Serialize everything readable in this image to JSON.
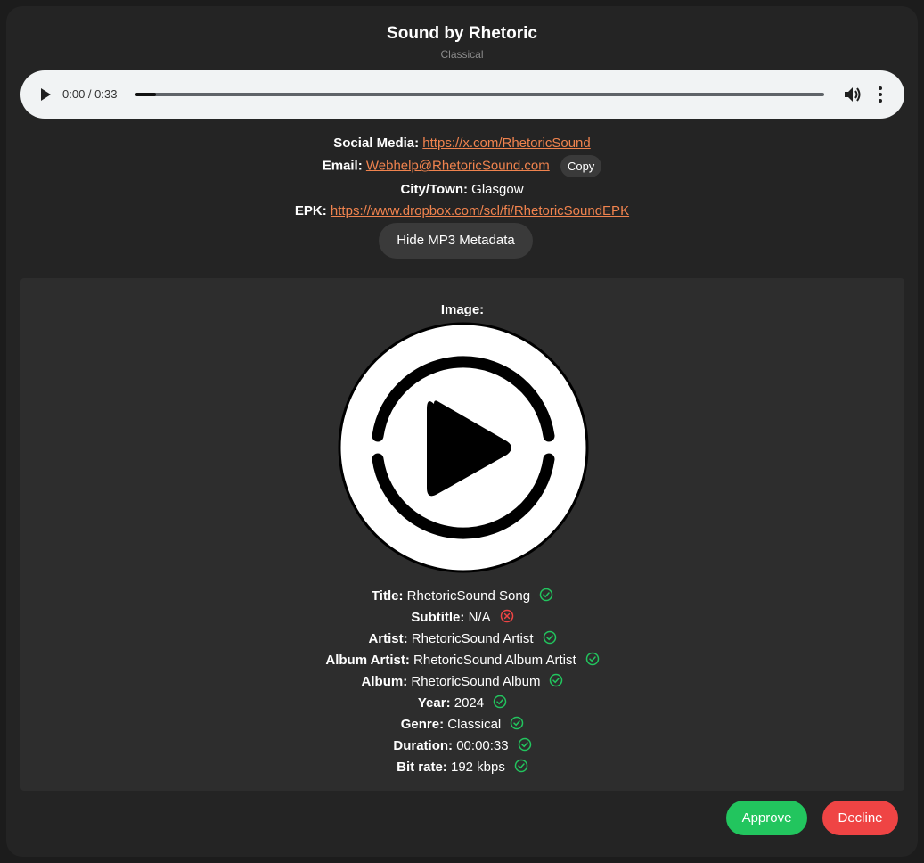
{
  "header": {
    "title": "Sound by Rhetoric",
    "genre": "Classical"
  },
  "player": {
    "time": "0:00 / 0:33",
    "progress_fraction": 0.03,
    "play_icon": "play-icon",
    "volume_icon": "volume-icon",
    "more_icon": "more-vertical-icon"
  },
  "info": {
    "social_label": "Social Media:",
    "social_value": "https://x.com/RhetoricSound",
    "email_label": "Email:",
    "email_value": "Webhelp@RhetoricSound.com",
    "copy_label": "Copy",
    "city_label": "City/Town:",
    "city_value": "Glasgow",
    "epk_label": "EPK:",
    "epk_value": "https://www.dropbox.com/scl/fi/RhetoricSoundEPK"
  },
  "toggle": {
    "label": "Hide MP3 Metadata"
  },
  "metadata": {
    "image_label": "Image:",
    "rows": [
      {
        "label": "Title:",
        "value": "RhetoricSound Song",
        "ok": true
      },
      {
        "label": "Subtitle:",
        "value": "N/A",
        "ok": false
      },
      {
        "label": "Artist:",
        "value": "RhetoricSound Artist",
        "ok": true
      },
      {
        "label": "Album Artist:",
        "value": "RhetoricSound Album Artist",
        "ok": true
      },
      {
        "label": "Album:",
        "value": "RhetoricSound Album",
        "ok": true
      },
      {
        "label": "Year:",
        "value": "2024",
        "ok": true
      },
      {
        "label": "Genre:",
        "value": "Classical",
        "ok": true
      },
      {
        "label": "Duration:",
        "value": "00:00:33",
        "ok": true
      },
      {
        "label": "Bit rate:",
        "value": "192 kbps",
        "ok": true
      }
    ]
  },
  "actions": {
    "approve_label": "Approve",
    "decline_label": "Decline"
  },
  "colors": {
    "link": "#f0834e",
    "ok": "#22c55e",
    "error": "#ef4444"
  }
}
